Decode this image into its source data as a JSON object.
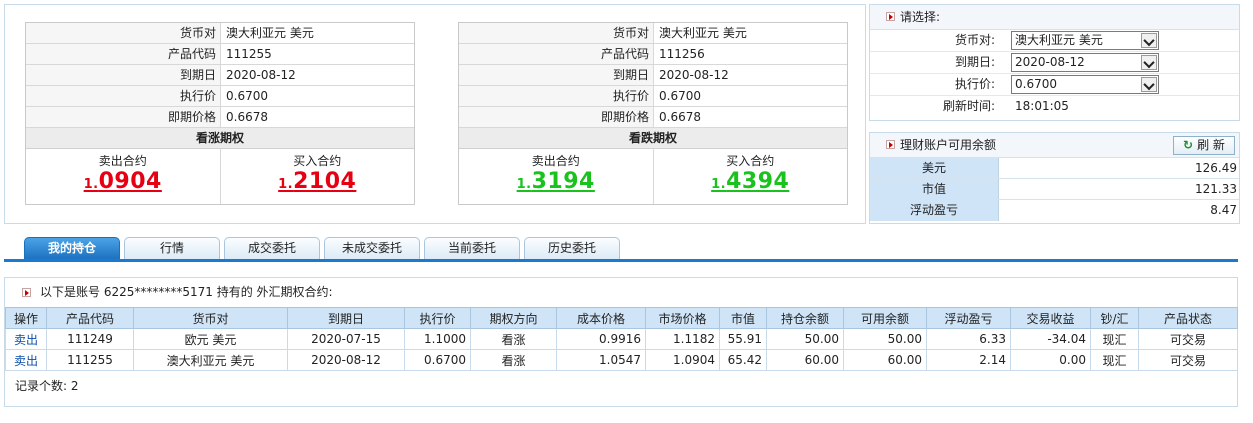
{
  "quotes": [
    {
      "rows": [
        {
          "label": "货币对",
          "value": "澳大利亚元 美元"
        },
        {
          "label": "产品代码",
          "value": "111255"
        },
        {
          "label": "到期日",
          "value": "2020-08-12"
        },
        {
          "label": "执行价",
          "value": "0.6700"
        },
        {
          "label": "即期价格",
          "value": "0.6678"
        }
      ],
      "title": "看涨期权",
      "sell_label": "卖出合约",
      "sell_prefix": "1.",
      "sell_price": "0904",
      "buy_label": "买入合约",
      "buy_prefix": "1.",
      "buy_price": "2104",
      "price_color": "#e60012"
    },
    {
      "rows": [
        {
          "label": "货币对",
          "value": "澳大利亚元 美元"
        },
        {
          "label": "产品代码",
          "value": "111256"
        },
        {
          "label": "到期日",
          "value": "2020-08-12"
        },
        {
          "label": "执行价",
          "value": "0.6700"
        },
        {
          "label": "即期价格",
          "value": "0.6678"
        }
      ],
      "title": "看跌期权",
      "sell_label": "卖出合约",
      "sell_prefix": "1.",
      "sell_price": "3194",
      "buy_label": "买入合约",
      "buy_prefix": "1.",
      "buy_price": "4394",
      "price_color": "#19c21d"
    }
  ],
  "select_panel": {
    "title": "请选择:",
    "currency_pair_label": "货币对:",
    "currency_pair_value": "澳大利亚元 美元",
    "expiry_label": "到期日:",
    "expiry_value": "2020-08-12",
    "strike_label": "执行价:",
    "strike_value": "0.6700",
    "refresh_time_label": "刷新时间:",
    "refresh_time_value": "18:01:05"
  },
  "balance_panel": {
    "title": "理财账户可用余额",
    "refresh_label": "刷 新",
    "rows": [
      {
        "label": "美元",
        "value": "126.49"
      },
      {
        "label": "市值",
        "value": "121.33"
      },
      {
        "label": "浮动盈亏",
        "value": "8.47"
      }
    ]
  },
  "tabs": [
    "我的持仓",
    "行情",
    "成交委托",
    "未成交委托",
    "当前委托",
    "历史委托"
  ],
  "holdings": {
    "header": "以下是账号 6225********5171 持有的 外汇期权合约:",
    "columns": [
      "操作",
      "产品代码",
      "货币对",
      "到期日",
      "执行价",
      "期权方向",
      "成本价格",
      "市场价格",
      "市值",
      "持仓余额",
      "可用余额",
      "浮动盈亏",
      "交易收益",
      "钞/汇",
      "产品状态"
    ],
    "rows": [
      [
        "卖出",
        "111249",
        "欧元 美元",
        "2020-07-15",
        "1.1000",
        "看涨",
        "0.9916",
        "1.1182",
        "55.91",
        "50.00",
        "50.00",
        "6.33",
        "-34.04",
        "现汇",
        "可交易"
      ],
      [
        "卖出",
        "111255",
        "澳大利亚元 美元",
        "2020-08-12",
        "0.6700",
        "看涨",
        "1.0547",
        "1.0904",
        "65.42",
        "60.00",
        "60.00",
        "2.14",
        "0.00",
        "现汇",
        "可交易"
      ]
    ],
    "record_count_label": "记录个数:",
    "record_count": "2"
  }
}
